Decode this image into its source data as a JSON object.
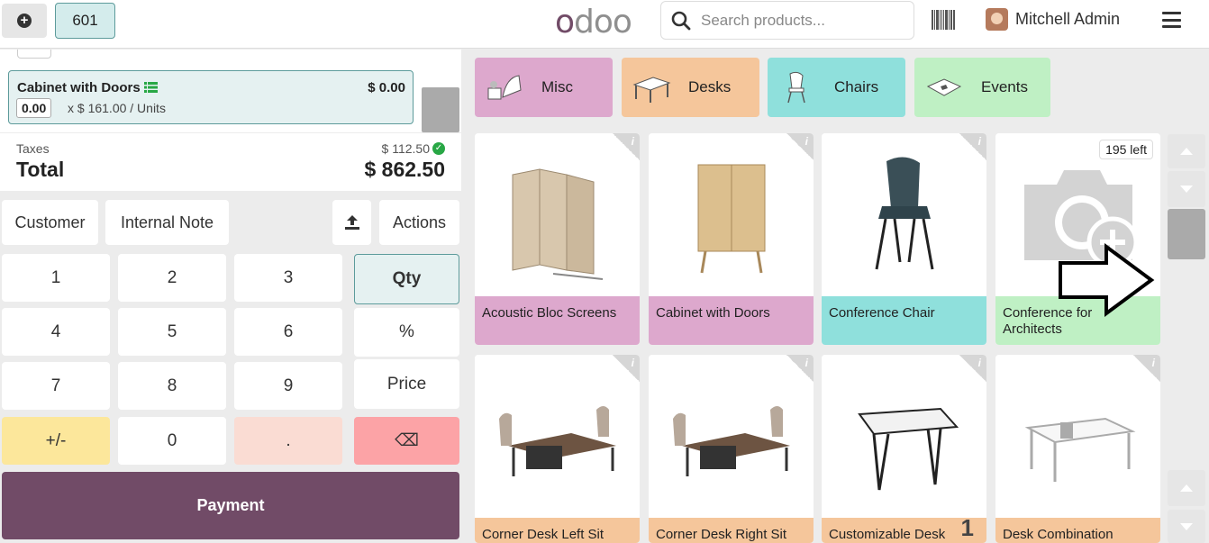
{
  "header": {
    "order_number": "601",
    "logo_text": "odoo",
    "search_placeholder": "Search products...",
    "user_name": "Mitchell Admin"
  },
  "order": {
    "line": {
      "product": "Cabinet with Doors",
      "price": "$ 0.00",
      "qty": "0.00",
      "unit_price": "x $ 161.00 / Units"
    },
    "taxes_label": "Taxes",
    "taxes_value": "$ 112.50",
    "total_label": "Total",
    "total_value": "$ 862.50"
  },
  "controls": {
    "customer": "Customer",
    "internal_note": "Internal Note",
    "actions": "Actions"
  },
  "numpad": {
    "k1": "1",
    "k2": "2",
    "k3": "3",
    "k4": "4",
    "k5": "5",
    "k6": "6",
    "k7": "7",
    "k8": "8",
    "k9": "9",
    "plusminus": "+/-",
    "k0": "0",
    "dot": ".",
    "backspace": "⌫",
    "qty": "Qty",
    "percent": "%",
    "price": "Price"
  },
  "payment_label": "Payment",
  "categories": [
    {
      "name": "Misc",
      "color": "#dda8cd",
      "icon": "misc-icon"
    },
    {
      "name": "Desks",
      "color": "#f5c69b",
      "icon": "desk-icon"
    },
    {
      "name": "Chairs",
      "color": "#8fe0dc",
      "icon": "chair-icon"
    },
    {
      "name": "Events",
      "color": "#bff0c4",
      "icon": "events-icon"
    }
  ],
  "products": [
    {
      "name": "Acoustic Bloc Screens",
      "color": "#dda8cd"
    },
    {
      "name": "Cabinet with Doors",
      "color": "#dda8cd"
    },
    {
      "name": "Conference Chair",
      "color": "#8fe0dc"
    },
    {
      "name": "Conference for Architects",
      "color": "#bff0c4",
      "badge": "195 left"
    },
    {
      "name": "Corner Desk Left Sit",
      "color": "#f5c69b"
    },
    {
      "name": "Corner Desk Right Sit",
      "color": "#f5c69b"
    },
    {
      "name": "Customizable Desk",
      "color": "#f5c69b",
      "qty_badge": "1"
    },
    {
      "name": "Desk Combination",
      "color": "#f5c69b"
    }
  ]
}
